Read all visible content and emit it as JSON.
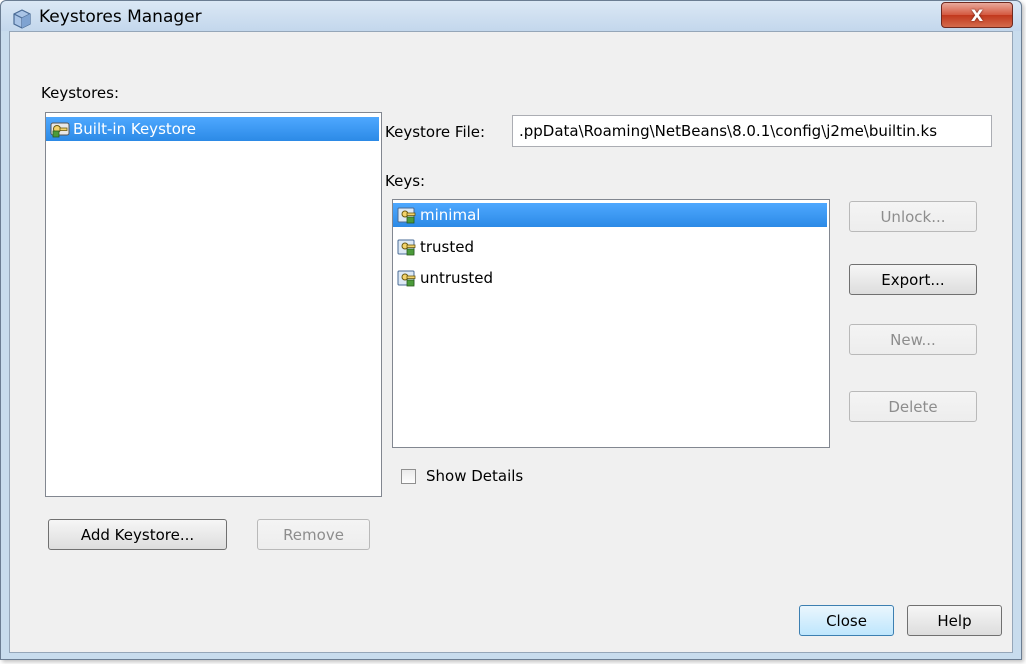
{
  "window": {
    "title": "Keystores Manager",
    "close_glyph": "X"
  },
  "keystores": {
    "label": "Keystores:",
    "items": [
      {
        "label": "Built-in Keystore",
        "icon": "keystore-icon",
        "selected": true
      }
    ],
    "add_label": "Add Keystore...",
    "remove_label": "Remove"
  },
  "keystore_file": {
    "label": "Keystore File:",
    "value": ".ppData\\Roaming\\NetBeans\\8.0.1\\config\\j2me\\builtin.ks"
  },
  "keys": {
    "label": "Keys:",
    "items": [
      {
        "label": "minimal",
        "icon": "key-icon",
        "selected": true
      },
      {
        "label": "trusted",
        "icon": "key-icon",
        "selected": false
      },
      {
        "label": "untrusted",
        "icon": "key-icon",
        "selected": false
      }
    ],
    "unlock_label": "Unlock...",
    "export_label": "Export...",
    "new_label": "New...",
    "delete_label": "Delete"
  },
  "show_details": {
    "label": "Show Details",
    "checked": false
  },
  "footer": {
    "close_label": "Close",
    "help_label": "Help"
  }
}
